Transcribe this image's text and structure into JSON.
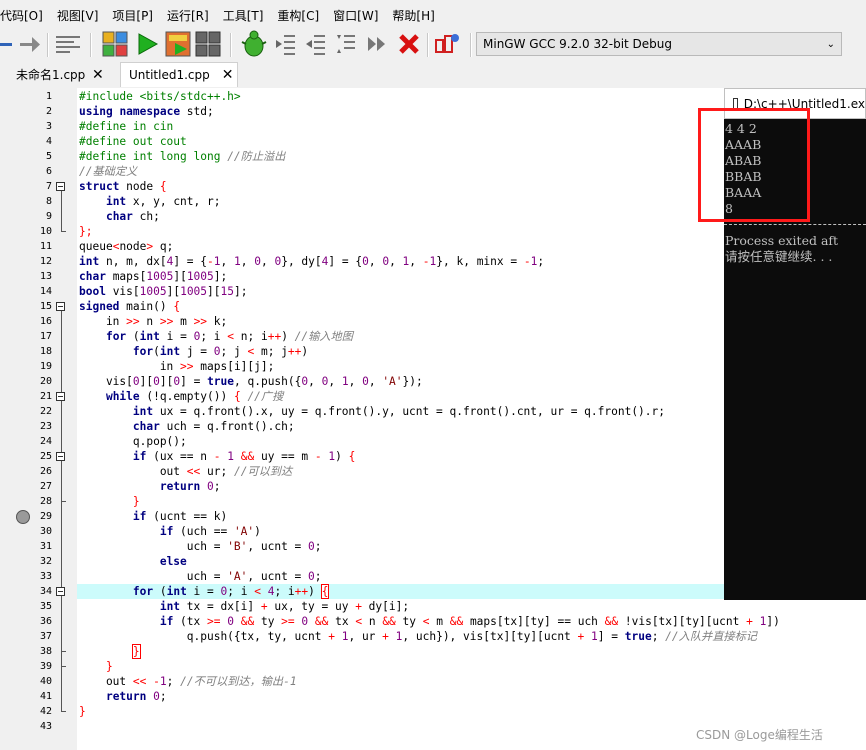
{
  "menu": [
    "代码[O]",
    "视图[V]",
    "项目[P]",
    "运行[R]",
    "工具[T]",
    "重构[C]",
    "窗口[W]",
    "帮助[H]"
  ],
  "toolbar": {
    "icons": [
      "back-arrow-icon",
      "forward-arrow-icon",
      "format-icon",
      "compile-icon",
      "run-icon",
      "compile-run-icon",
      "rebuild-icon",
      "debug-icon",
      "indent-icon",
      "unindent-icon",
      "toggle-comment-icon",
      "goto-icon",
      "stop-icon",
      "profile-icon"
    ],
    "compiler_label": "MinGW GCC 9.2.0 32-bit Debug"
  },
  "tabs": [
    {
      "label": "未命名1.cpp",
      "active": false
    },
    {
      "label": "Untitled1.cpp",
      "active": true
    }
  ],
  "editor": {
    "current_line": 34,
    "breakpoint_line": 29,
    "lines": [
      [
        [
          "pp",
          "#include <bits/stdc++.h>"
        ]
      ],
      [
        [
          "kw",
          "using"
        ],
        [
          "t",
          " "
        ],
        [
          "kw",
          "namespace"
        ],
        [
          "t",
          " std;"
        ]
      ],
      [
        [
          "pp",
          "#define in cin"
        ]
      ],
      [
        [
          "pp",
          "#define out cout"
        ]
      ],
      [
        [
          "pp",
          "#define int long long "
        ],
        [
          "cm",
          "//防止溢出"
        ]
      ],
      [
        [
          "cm",
          "//基础定义"
        ]
      ],
      [
        [
          "kw",
          "struct"
        ],
        [
          "t",
          " node "
        ],
        [
          "op",
          "{"
        ]
      ],
      [
        [
          "t",
          "    "
        ],
        [
          "ty",
          "int"
        ],
        [
          "t",
          " x, y, cnt, r;"
        ]
      ],
      [
        [
          "t",
          "    "
        ],
        [
          "ty",
          "char"
        ],
        [
          "t",
          " ch;"
        ]
      ],
      [
        [
          "op",
          "};"
        ]
      ],
      [
        [
          "t",
          "queue"
        ],
        [
          "op",
          "<"
        ],
        [
          "t",
          "node"
        ],
        [
          "op",
          ">"
        ],
        [
          "t",
          " q;"
        ]
      ],
      [
        [
          "ty",
          "int"
        ],
        [
          "t",
          " n, m, dx["
        ],
        [
          "nm",
          "4"
        ],
        [
          "t",
          "] = {"
        ],
        [
          "op",
          "-"
        ],
        [
          "nm",
          "1"
        ],
        [
          "t",
          ", "
        ],
        [
          "nm",
          "1"
        ],
        [
          "t",
          ", "
        ],
        [
          "nm",
          "0"
        ],
        [
          "t",
          ", "
        ],
        [
          "nm",
          "0"
        ],
        [
          "t",
          "}, dy["
        ],
        [
          "nm",
          "4"
        ],
        [
          "t",
          "] = {"
        ],
        [
          "nm",
          "0"
        ],
        [
          "t",
          ", "
        ],
        [
          "nm",
          "0"
        ],
        [
          "t",
          ", "
        ],
        [
          "nm",
          "1"
        ],
        [
          "t",
          ", "
        ],
        [
          "op",
          "-"
        ],
        [
          "nm",
          "1"
        ],
        [
          "t",
          "}, k, minx = "
        ],
        [
          "op",
          "-"
        ],
        [
          "nm",
          "1"
        ],
        [
          "t",
          ";"
        ]
      ],
      [
        [
          "ty",
          "char"
        ],
        [
          "t",
          " maps["
        ],
        [
          "nm",
          "1005"
        ],
        [
          "t",
          "]["
        ],
        [
          "nm",
          "1005"
        ],
        [
          "t",
          "];"
        ]
      ],
      [
        [
          "ty",
          "bool"
        ],
        [
          "t",
          " vis["
        ],
        [
          "nm",
          "1005"
        ],
        [
          "t",
          "]["
        ],
        [
          "nm",
          "1005"
        ],
        [
          "t",
          "]["
        ],
        [
          "nm",
          "15"
        ],
        [
          "t",
          "];"
        ]
      ],
      [
        [
          "ty",
          "signed"
        ],
        [
          "t",
          " main() "
        ],
        [
          "op",
          "{"
        ]
      ],
      [
        [
          "t",
          "    in "
        ],
        [
          "op",
          ">>"
        ],
        [
          "t",
          " n "
        ],
        [
          "op",
          ">>"
        ],
        [
          "t",
          " m "
        ],
        [
          "op",
          ">>"
        ],
        [
          "t",
          " k;"
        ]
      ],
      [
        [
          "t",
          "    "
        ],
        [
          "kw",
          "for"
        ],
        [
          "t",
          " ("
        ],
        [
          "ty",
          "int"
        ],
        [
          "t",
          " i = "
        ],
        [
          "nm",
          "0"
        ],
        [
          "t",
          "; i "
        ],
        [
          "op",
          "<"
        ],
        [
          "t",
          " n; i"
        ],
        [
          "op",
          "++"
        ],
        [
          "t",
          ") "
        ],
        [
          "cm",
          "//输入地图"
        ]
      ],
      [
        [
          "t",
          "        "
        ],
        [
          "kw",
          "for"
        ],
        [
          "t",
          "("
        ],
        [
          "ty",
          "int"
        ],
        [
          "t",
          " j = "
        ],
        [
          "nm",
          "0"
        ],
        [
          "t",
          "; j "
        ],
        [
          "op",
          "<"
        ],
        [
          "t",
          " m; j"
        ],
        [
          "op",
          "++"
        ],
        [
          "t",
          ")"
        ]
      ],
      [
        [
          "t",
          "            in "
        ],
        [
          "op",
          ">>"
        ],
        [
          "t",
          " maps[i][j];"
        ]
      ],
      [
        [
          "t",
          "    vis["
        ],
        [
          "nm",
          "0"
        ],
        [
          "t",
          "]["
        ],
        [
          "nm",
          "0"
        ],
        [
          "t",
          "]["
        ],
        [
          "nm",
          "0"
        ],
        [
          "t",
          "] = "
        ],
        [
          "kw",
          "true"
        ],
        [
          "t",
          ", q.push({"
        ],
        [
          "nm",
          "0"
        ],
        [
          "t",
          ", "
        ],
        [
          "nm",
          "0"
        ],
        [
          "t",
          ", "
        ],
        [
          "nm",
          "1"
        ],
        [
          "t",
          ", "
        ],
        [
          "nm",
          "0"
        ],
        [
          "t",
          ", "
        ],
        [
          "st",
          "'A'"
        ],
        [
          "t",
          "});"
        ]
      ],
      [
        [
          "t",
          "    "
        ],
        [
          "kw",
          "while"
        ],
        [
          "t",
          " (!q.empty()) "
        ],
        [
          "op",
          "{"
        ],
        [
          "t",
          " "
        ],
        [
          "cm",
          "//广搜"
        ]
      ],
      [
        [
          "t",
          "        "
        ],
        [
          "ty",
          "int"
        ],
        [
          "t",
          " ux = q.front().x, uy = q.front().y, ucnt = q.front().cnt, ur = q.front().r;"
        ]
      ],
      [
        [
          "t",
          "        "
        ],
        [
          "ty",
          "char"
        ],
        [
          "t",
          " uch = q.front().ch;"
        ]
      ],
      [
        [
          "t",
          "        q.pop();"
        ]
      ],
      [
        [
          "t",
          "        "
        ],
        [
          "kw",
          "if"
        ],
        [
          "t",
          " (ux == n "
        ],
        [
          "op",
          "-"
        ],
        [
          "t",
          " "
        ],
        [
          "nm",
          "1"
        ],
        [
          "t",
          " "
        ],
        [
          "op",
          "&&"
        ],
        [
          "t",
          " uy == m "
        ],
        [
          "op",
          "-"
        ],
        [
          "t",
          " "
        ],
        [
          "nm",
          "1"
        ],
        [
          "t",
          ") "
        ],
        [
          "op",
          "{"
        ]
      ],
      [
        [
          "t",
          "            out "
        ],
        [
          "op",
          "<<"
        ],
        [
          "t",
          " ur; "
        ],
        [
          "cm",
          "//可以到达"
        ]
      ],
      [
        [
          "t",
          "            "
        ],
        [
          "kw",
          "return"
        ],
        [
          "t",
          " "
        ],
        [
          "nm",
          "0"
        ],
        [
          "t",
          ";"
        ]
      ],
      [
        [
          "t",
          "        "
        ],
        [
          "op",
          "}"
        ]
      ],
      [
        [
          "t",
          "        "
        ],
        [
          "kw",
          "if"
        ],
        [
          "t",
          " (ucnt == k)"
        ]
      ],
      [
        [
          "t",
          "            "
        ],
        [
          "kw",
          "if"
        ],
        [
          "t",
          " (uch == "
        ],
        [
          "st",
          "'A'"
        ],
        [
          "t",
          ")"
        ]
      ],
      [
        [
          "t",
          "                uch = "
        ],
        [
          "st",
          "'B'"
        ],
        [
          "t",
          ", ucnt = "
        ],
        [
          "nm",
          "0"
        ],
        [
          "t",
          ";"
        ]
      ],
      [
        [
          "t",
          "            "
        ],
        [
          "kw",
          "else"
        ]
      ],
      [
        [
          "t",
          "                uch = "
        ],
        [
          "st",
          "'A'"
        ],
        [
          "t",
          ", ucnt = "
        ],
        [
          "nm",
          "0"
        ],
        [
          "t",
          ";"
        ]
      ],
      [
        [
          "t",
          "        "
        ],
        [
          "kw",
          "for"
        ],
        [
          "t",
          " ("
        ],
        [
          "ty",
          "int"
        ],
        [
          "t",
          " i = "
        ],
        [
          "nm",
          "0"
        ],
        [
          "t",
          "; i "
        ],
        [
          "op",
          "<"
        ],
        [
          "t",
          " "
        ],
        [
          "nm",
          "4"
        ],
        [
          "t",
          "; i"
        ],
        [
          "op",
          "++"
        ],
        [
          "t",
          ") "
        ],
        [
          "m",
          "{"
        ]
      ],
      [
        [
          "t",
          "            "
        ],
        [
          "ty",
          "int"
        ],
        [
          "t",
          " tx = dx[i] "
        ],
        [
          "op",
          "+"
        ],
        [
          "t",
          " ux, ty = uy "
        ],
        [
          "op",
          "+"
        ],
        [
          "t",
          " dy[i];"
        ]
      ],
      [
        [
          "t",
          "            "
        ],
        [
          "kw",
          "if"
        ],
        [
          "t",
          " (tx "
        ],
        [
          "op",
          ">="
        ],
        [
          "t",
          " "
        ],
        [
          "nm",
          "0"
        ],
        [
          "t",
          " "
        ],
        [
          "op",
          "&&"
        ],
        [
          "t",
          " ty "
        ],
        [
          "op",
          ">="
        ],
        [
          "t",
          " "
        ],
        [
          "nm",
          "0"
        ],
        [
          "t",
          " "
        ],
        [
          "op",
          "&&"
        ],
        [
          "t",
          " tx "
        ],
        [
          "op",
          "<"
        ],
        [
          "t",
          " n "
        ],
        [
          "op",
          "&&"
        ],
        [
          "t",
          " ty "
        ],
        [
          "op",
          "<"
        ],
        [
          "t",
          " m "
        ],
        [
          "op",
          "&&"
        ],
        [
          "t",
          " maps[tx][ty] == uch "
        ],
        [
          "op",
          "&&"
        ],
        [
          "t",
          " !vis[tx][ty][ucnt "
        ],
        [
          "op",
          "+"
        ],
        [
          "t",
          " "
        ],
        [
          "nm",
          "1"
        ],
        [
          "t",
          "])"
        ]
      ],
      [
        [
          "t",
          "                q.push({tx, ty, ucnt "
        ],
        [
          "op",
          "+"
        ],
        [
          "t",
          " "
        ],
        [
          "nm",
          "1"
        ],
        [
          "t",
          ", ur "
        ],
        [
          "op",
          "+"
        ],
        [
          "t",
          " "
        ],
        [
          "nm",
          "1"
        ],
        [
          "t",
          ", uch}), vis[tx][ty][ucnt "
        ],
        [
          "op",
          "+"
        ],
        [
          "t",
          " "
        ],
        [
          "nm",
          "1"
        ],
        [
          "t",
          "] = "
        ],
        [
          "kw",
          "true"
        ],
        [
          "t",
          "; "
        ],
        [
          "cm",
          "//入队并直接标记"
        ]
      ],
      [
        [
          "t",
          "        "
        ],
        [
          "m",
          "}"
        ]
      ],
      [
        [
          "t",
          "    "
        ],
        [
          "op",
          "}"
        ]
      ],
      [
        [
          "t",
          "    out "
        ],
        [
          "op",
          "<<"
        ],
        [
          "t",
          " "
        ],
        [
          "op",
          "-"
        ],
        [
          "nm",
          "1"
        ],
        [
          "t",
          "; "
        ],
        [
          "cm",
          "//不可以到达，输出-1"
        ]
      ],
      [
        [
          "t",
          "    "
        ],
        [
          "kw",
          "return"
        ],
        [
          "t",
          " "
        ],
        [
          "nm",
          "0"
        ],
        [
          "t",
          ";"
        ]
      ],
      [
        [
          "op",
          "}"
        ]
      ],
      [
        [
          "t",
          ""
        ]
      ]
    ]
  },
  "console": {
    "title": "D:\\c++\\Untitled1.ex",
    "lines": [
      "4 4 2",
      "AAAB",
      "ABAB",
      "BBAB",
      "BAAA",
      "8"
    ],
    "footer": [
      "Process exited aft",
      "请按任意键继续. . ."
    ]
  },
  "watermark": "CSDN @Loge编程生活"
}
